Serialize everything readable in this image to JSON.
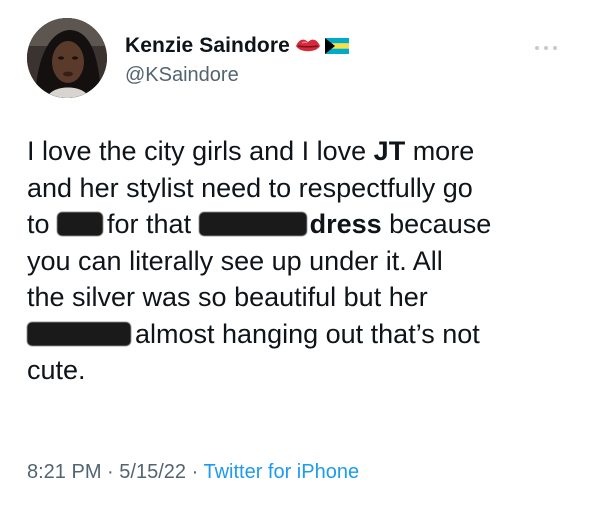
{
  "author": {
    "display_name": "Kenzie Saindore",
    "handle": "@KSaindore",
    "badges": [
      "lips-emoji-icon",
      "bahamas-flag-icon"
    ]
  },
  "tweet": {
    "lines": [
      {
        "segments": [
          "I love the city girls and I love ",
          "JT",
          " more"
        ]
      },
      {
        "text": "and her stylist need to respectfully go"
      },
      {
        "segments": [
          "to ",
          "for that ",
          "dress",
          " because"
        ]
      },
      {
        "text": "you can literally see up under it. All"
      },
      {
        "text": "the silver was so beautiful but her"
      },
      {
        "segments": [
          "almost hanging out that’s not"
        ]
      },
      {
        "text": "cute."
      }
    ]
  },
  "meta": {
    "time": "8:21 PM",
    "separator": "·",
    "date": "5/15/22",
    "source": "Twitter for iPhone"
  },
  "colors": {
    "text": "#0f1419",
    "secondary": "#536471",
    "link": "#1d9bf0",
    "redaction": "#1a1a1a"
  }
}
